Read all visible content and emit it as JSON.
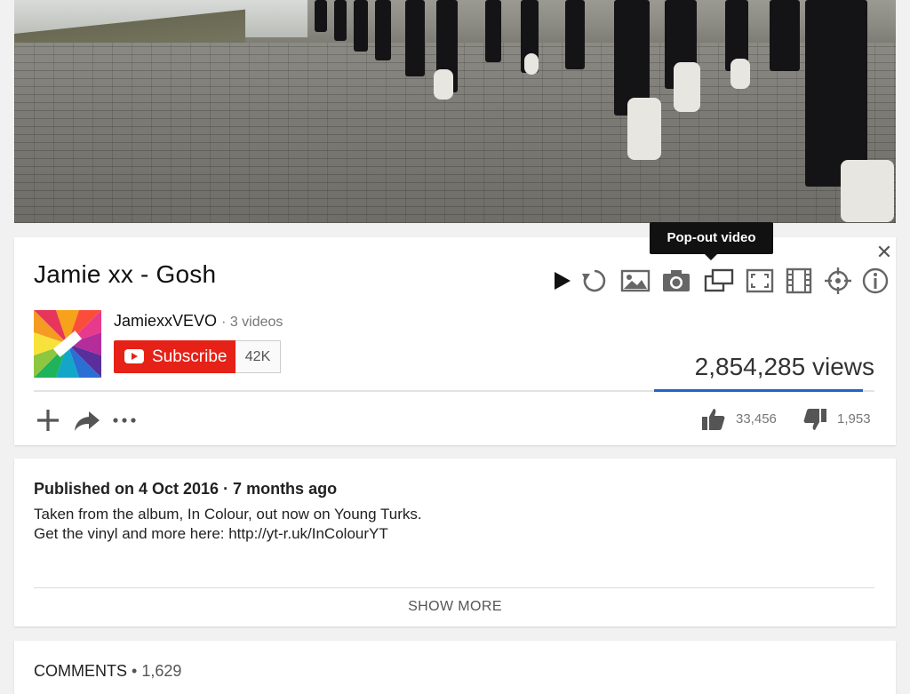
{
  "video": {
    "title": "Jamie xx - Gosh"
  },
  "tooltip": {
    "text": "Pop-out video"
  },
  "toolbar": {
    "icons": [
      "play-icon",
      "replay-icon",
      "image-icon",
      "camera-icon",
      "popout-icon",
      "fullscreen-icon",
      "film-icon",
      "crosshair-icon",
      "info-icon"
    ]
  },
  "channel": {
    "name": "JamiexxVEVO",
    "video_count": "· 3 videos",
    "subscribe_label": "Subscribe",
    "subscriber_count": "42K"
  },
  "stats": {
    "views": "2,854,285 views",
    "likes": "33,456",
    "dislikes": "1,953"
  },
  "description": {
    "published": "Published on 4 Oct 2016 · 7 months ago",
    "line1": "Taken from the album, In Colour, out now on Young Turks.",
    "line2": "Get the vinyl and more here: http://yt-r.uk/InColourYT",
    "show_more": "SHOW MORE"
  },
  "comments": {
    "label": "COMMENTS",
    "count": "• 1,629"
  },
  "colors": {
    "subscribe": "#e62117",
    "sentiment_bar": "#1f65c7",
    "card_bg": "#ffffff",
    "page_bg": "#f1f1f1"
  }
}
